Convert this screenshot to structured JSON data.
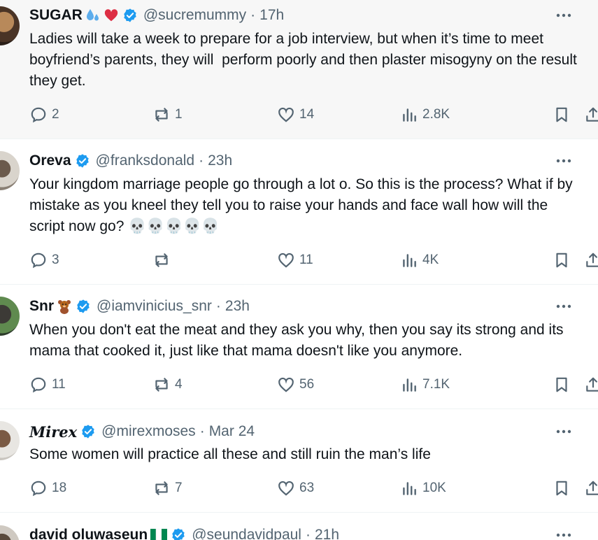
{
  "tweets": [
    {
      "name": "SUGAR",
      "emoji": [
        "sweat-droplets",
        "red-heart"
      ],
      "handle": "@sucremummy",
      "time": "17h",
      "text": "Ladies will take a week to prepare for a job interview, but when it’s time to meet boyfriend’s parents, they will  perform poorly and then plaster misogyny on the result they get.",
      "replies": "2",
      "reposts": "1",
      "likes": "14",
      "views": "2.8K"
    },
    {
      "name": "Oreva",
      "emoji": [],
      "handle": "@franksdonald",
      "time": "23h",
      "text": "Your kingdom marriage people go through a lot o. So this is the process? What if by mistake as you kneel they tell you to raise your hands and face wall how will the script now go? 💀💀💀💀💀",
      "replies": "3",
      "reposts": "",
      "likes": "11",
      "views": "4K"
    },
    {
      "name": "Snr",
      "emoji": [
        "teddy-bear"
      ],
      "handle": "@iamvinicius_snr",
      "time": "23h",
      "text": "When you don't eat the meat and they ask you why, then you say its strong and its mama that cooked it, just like that mama doesn't like you anymore.",
      "replies": "11",
      "reposts": "4",
      "likes": "56",
      "views": "7.1K"
    },
    {
      "name": "Mirex",
      "emoji": [],
      "handle": "@mirexmoses",
      "time": "Mar 24",
      "text": "Some women will practice all these and still ruin the man’s life",
      "replies": "18",
      "reposts": "7",
      "likes": "63",
      "views": "10K"
    },
    {
      "name": "david oluwaseun",
      "emoji": [
        "nigeria-flag"
      ],
      "handle": "@seundavidpaul",
      "time": "21h"
    }
  ],
  "colors": {
    "verified": "#1d9bf0",
    "secondary_text": "#536471",
    "highlight_bg": "#f7f7f7"
  },
  "icons": [
    "reply-icon",
    "repost-icon",
    "like-icon",
    "views-icon",
    "bookmark-icon",
    "share-icon",
    "more-icon",
    "verified-badge-icon"
  ]
}
